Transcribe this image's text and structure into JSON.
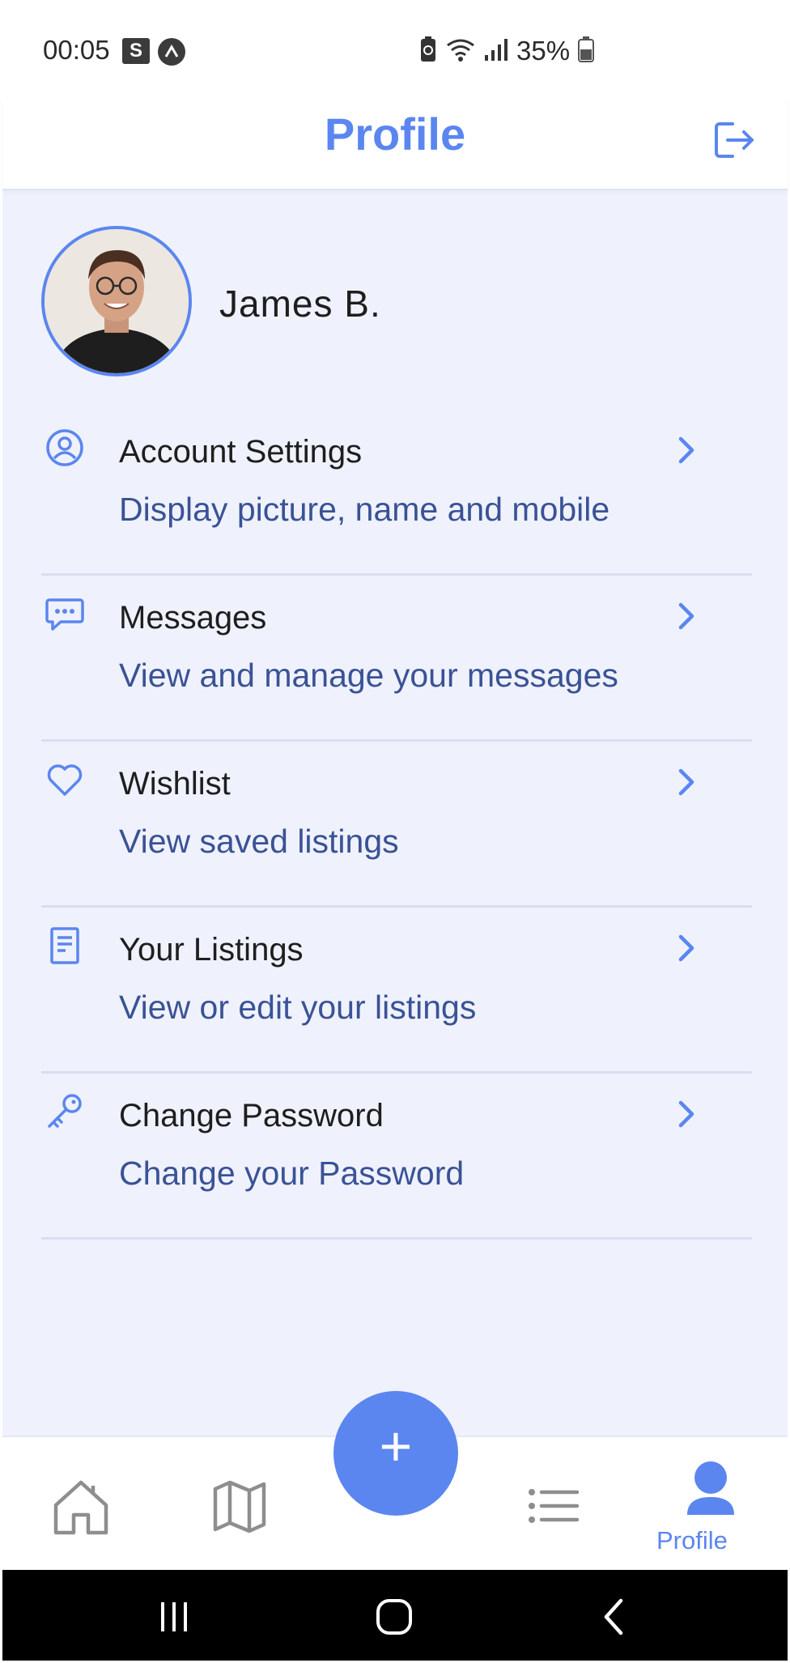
{
  "status_bar": {
    "time": "00:05",
    "badge_s": "S",
    "battery": "35%"
  },
  "header": {
    "title": "Profile"
  },
  "profile": {
    "name": "James B."
  },
  "menu": {
    "items": [
      {
        "icon": "user-circle-icon",
        "title": "Account Settings",
        "subtitle": "Display picture, name and mobile"
      },
      {
        "icon": "chat-bubble-icon",
        "title": "Messages",
        "subtitle": "View and manage your messages"
      },
      {
        "icon": "heart-icon",
        "title": "Wishlist",
        "subtitle": "View saved listings"
      },
      {
        "icon": "document-icon",
        "title": "Your Listings",
        "subtitle": "View or edit your listings"
      },
      {
        "icon": "key-icon",
        "title": "Change Password",
        "subtitle": "Change your Password"
      }
    ]
  },
  "bottom_nav": {
    "fab_label": "+",
    "active_label": "Profile"
  },
  "colors": {
    "accent": "#5b86f0",
    "background": "#eff2fd",
    "subtitle": "#3a5295"
  }
}
